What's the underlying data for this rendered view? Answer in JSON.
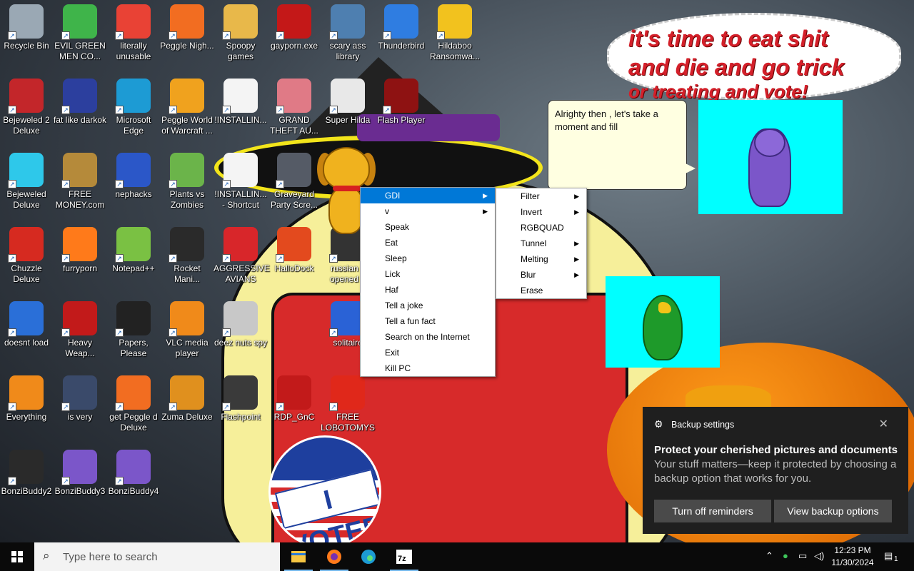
{
  "wallpaper": {
    "balloon_text_1": "it's time to eat shit",
    "balloon_text_2": "and die and go trick",
    "balloon_text_3": "or treating and vote!",
    "sticker_text": "I VOTED"
  },
  "desktop_icons": [
    {
      "label": "Recycle Bin",
      "icon": "recycle-bin-icon",
      "color": "#9aa8b4"
    },
    {
      "label": "EVIL GREEN MEN CO...",
      "icon": "green-men-icon",
      "color": "#3fb44a"
    },
    {
      "label": "literally unusable",
      "icon": "chrome-icon",
      "color": "#e94235"
    },
    {
      "label": "Peggle Nigh...",
      "icon": "peggle-icon",
      "color": "#f26d21"
    },
    {
      "label": "Spoopy games",
      "icon": "folder-icon",
      "color": "#e8b84a"
    },
    {
      "label": "gayporn.exe",
      "icon": "flash-icon",
      "color": "#c41818"
    },
    {
      "label": "scary ass library",
      "icon": "library-icon",
      "color": "#4e7fb0"
    },
    {
      "label": "Thunderbird",
      "icon": "thunderbird-icon",
      "color": "#2f7de1"
    },
    {
      "label": "Hildaboo Ransomwa...",
      "icon": "shield-icon",
      "color": "#f2c21e"
    },
    {
      "label": "Bejeweled 2 Deluxe",
      "icon": "bejeweled2-icon",
      "color": "#c3262a"
    },
    {
      "label": "fat like darkok",
      "icon": "mpi-icon",
      "color": "#2c3f9e"
    },
    {
      "label": "Microsoft Edge",
      "icon": "edge-icon",
      "color": "#1d9bd4"
    },
    {
      "label": "Peggle World of Warcraft ...",
      "icon": "peggle-wow-icon",
      "color": "#f0a21e"
    },
    {
      "label": "!INSTALLIN...",
      "icon": "document-icon",
      "color": "#f4f4f4"
    },
    {
      "label": "GRAND THEFT AU...",
      "icon": "gta-icon",
      "color": "#e07a86"
    },
    {
      "label": "Super Hilda",
      "icon": "hilda-icon",
      "color": "#e8e8e8"
    },
    {
      "label": "Flash Player",
      "icon": "flash-icon",
      "color": "#8e1212"
    },
    {
      "label": "Bejeweled Deluxe",
      "icon": "diamond-icon",
      "color": "#2ec8ea"
    },
    {
      "label": "FREE MONEY.com",
      "icon": "money-bag-icon",
      "color": "#b58a3a"
    },
    {
      "label": "nephacks",
      "icon": "mpi-icon",
      "color": "#2b57c8"
    },
    {
      "label": "Plants vs Zombies",
      "icon": "flower-icon",
      "color": "#6bb44a"
    },
    {
      "label": "!INSTALLIN... - Shortcut",
      "icon": "document-icon",
      "color": "#f4f4f4"
    },
    {
      "label": "Graveyard Party Scre...",
      "icon": "graveyard-icon",
      "color": "#555b66"
    },
    {
      "label": "Chuzzle Deluxe",
      "icon": "chuzzle-icon",
      "color": "#d62a20"
    },
    {
      "label": "furryporn",
      "icon": "firefox-icon",
      "color": "#ff7a1a"
    },
    {
      "label": "Notepad++",
      "icon": "notepad-icon",
      "color": "#7ac143"
    },
    {
      "label": "Rocket Mani...",
      "icon": "rocket-icon",
      "color": "#2a2a2a"
    },
    {
      "label": "AGGRESSIVE AVIANS",
      "icon": "angry-bird-icon",
      "color": "#d8262a"
    },
    {
      "label": "HalloDock",
      "icon": "windows-shield-icon",
      "color": "#e34a1e"
    },
    {
      "label": "russian k opened a",
      "icon": "russian-icon",
      "color": "#333333"
    },
    {
      "label": "doesnt load",
      "icon": "thunderbird-icon",
      "color": "#2a6fd8"
    },
    {
      "label": "Heavy Weap...",
      "icon": "radiation-icon",
      "color": "#c21a1a"
    },
    {
      "label": "Papers, Please",
      "icon": "papers-icon",
      "color": "#222222"
    },
    {
      "label": "VLC media player",
      "icon": "vlc-icon",
      "color": "#f08a1a"
    },
    {
      "label": "deez nuts spy",
      "icon": "copy-icon",
      "color": "#c8c8c8"
    },
    {
      "label": "solitaire",
      "icon": "solitaire-icon",
      "color": "#2a62d6"
    },
    {
      "label": "Everything",
      "icon": "magnifier-icon",
      "color": "#f08a1a"
    },
    {
      "label": "is very",
      "icon": "mpi-shield-icon",
      "color": "#3a4a6a"
    },
    {
      "label": "get Peggle d Deluxe",
      "icon": "peggle-icon",
      "color": "#f26d21"
    },
    {
      "label": "Zuma Deluxe",
      "icon": "zuma-icon",
      "color": "#e0901e"
    },
    {
      "label": "Flashpoint",
      "icon": "flashpoint-icon",
      "color": "#3a3a3a"
    },
    {
      "label": "RDP_GnC",
      "icon": "rdp-icon",
      "color": "#c21a1a"
    },
    {
      "label": "FREE LOBOTOMYS",
      "icon": "lobotomy-icon",
      "color": "#e0281a"
    },
    {
      "label": "BonziBuddy2",
      "icon": "window-icon",
      "color": "#2a2a2a"
    },
    {
      "label": "BonziBuddy3",
      "icon": "bonzi-icon",
      "color": "#7b56c9"
    },
    {
      "label": "BonziBuddy4",
      "icon": "bonzi-icon",
      "color": "#7b56c9"
    }
  ],
  "speech_bubble": {
    "text": "Alrighty then , let's take a moment and fill"
  },
  "context_menu": {
    "items": [
      {
        "label": "GDI",
        "submenu": true,
        "highlighted": true
      },
      {
        "label": "v",
        "submenu": true,
        "highlighted": false
      },
      {
        "label": "Speak",
        "submenu": false
      },
      {
        "label": "Eat",
        "submenu": false
      },
      {
        "label": "Sleep",
        "submenu": false
      },
      {
        "label": "Lick",
        "submenu": false
      },
      {
        "label": "Haf",
        "submenu": false
      },
      {
        "label": "Tell a joke",
        "submenu": false
      },
      {
        "label": "Tell a fun fact",
        "submenu": false
      },
      {
        "label": "Search on the Internet",
        "submenu": false
      },
      {
        "label": "Exit",
        "submenu": false
      },
      {
        "label": "Kill PC",
        "submenu": false
      }
    ],
    "submenu_items": [
      {
        "label": "Filter",
        "submenu": true
      },
      {
        "label": "Invert",
        "submenu": true
      },
      {
        "label": "RGBQUAD",
        "submenu": false
      },
      {
        "label": "Tunnel",
        "submenu": true
      },
      {
        "label": "Melting",
        "submenu": true
      },
      {
        "label": "Blur",
        "submenu": true
      },
      {
        "label": "Erase",
        "submenu": false
      }
    ]
  },
  "toast": {
    "header": "Backup settings",
    "title": "Protect your cherished pictures and documents",
    "body": "Your stuff matters—keep it protected by choosing a backup option that works for you.",
    "btn_left": "Turn off reminders",
    "btn_right": "View backup options"
  },
  "taskbar": {
    "search_placeholder": "Type here to search",
    "apps": [
      "file-explorer-icon",
      "firefox-icon",
      "edge-icon",
      "7zip-icon"
    ],
    "time": "12:23 PM",
    "date": "11/30/2024",
    "notification_count": "1"
  },
  "colors": {
    "accent": "#0078d7",
    "taskbar": "#0a0a0a",
    "toast_bg": "#1f1f1f"
  }
}
